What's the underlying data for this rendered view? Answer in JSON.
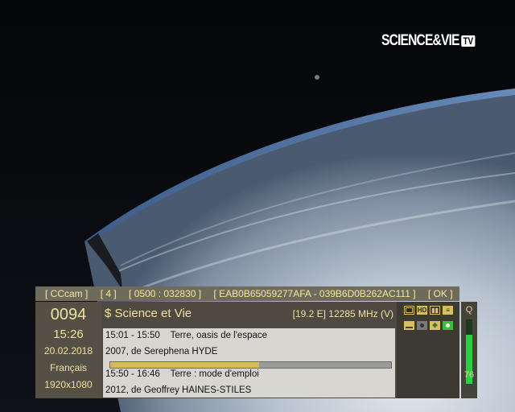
{
  "channel_logo": {
    "text": "SCIENCE&VIE",
    "badge": "TV"
  },
  "status_bar": {
    "cam": "[ CCcam ]",
    "slot": "[ 4 ]",
    "caid": "[ 0500 : 032830 ]",
    "cw": "[ EAB0B65059277AFA - 039B6D0B262AC111 ]",
    "result": "[ OK ]"
  },
  "info": {
    "channel_number": "0094",
    "time": "15:26",
    "date": "20.02.2018",
    "language": "Français",
    "resolution": "1920x1080"
  },
  "channel": {
    "name": "$ Science et Vie",
    "transponder": "[19.2 E] 12285 MHz (V)"
  },
  "epg": {
    "now": {
      "time": "15:01  - 15:50",
      "title": "Terre, oasis de l'espace",
      "details": "2007, de Serephena HYDE",
      "progress": 0.53
    },
    "next": {
      "time": "15:50  - 16:46",
      "title": "Terre : mode d'emploi",
      "details": "2012, de Geoffrey HAINES-STILES"
    }
  },
  "icons": [
    "tv-icon",
    "hd-icon",
    "dolby-icon",
    "teletext-icon",
    "subtitle-icon",
    "scrambled-icon",
    "network-icon",
    "record-icon"
  ],
  "signal": {
    "label": "Q",
    "value": "76",
    "level": 0.76
  },
  "colors": {
    "accent": "#f3e3a0",
    "panel": "#4e4a42",
    "status_bar": "#6f6b5c",
    "signal": "#28d23c"
  }
}
